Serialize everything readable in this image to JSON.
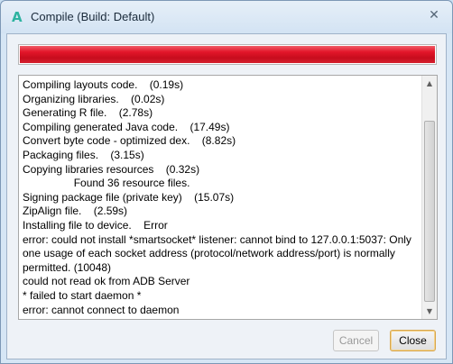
{
  "window": {
    "title": "Compile (Build: Default)",
    "icon": "android-a-icon",
    "close_glyph": "✕"
  },
  "progress": {
    "value": 1.0,
    "color": "#d9182a"
  },
  "log": {
    "lines": [
      "Compiling layouts code.    (0.19s)",
      "Organizing libraries.    (0.02s)",
      "Generating R file.    (2.78s)",
      "Compiling generated Java code.    (17.49s)",
      "Convert byte code - optimized dex.    (8.82s)",
      "Packaging files.    (3.15s)",
      "Copying libraries resources    (0.32s)",
      "                 Found 36 resource files.",
      "Signing package file (private key)    (15.07s)",
      "ZipAlign file.    (2.59s)",
      "Installing file to device.    Error",
      "error: could not install *smartsocket* listener: cannot bind to 127.0.0.1:5037: Only one usage of each socket address (protocol/network address/port) is normally permitted. (10048)",
      "could not read ok from ADB Server",
      "* failed to start daemon *",
      "error: cannot connect to daemon"
    ]
  },
  "buttons": {
    "cancel_label": "Cancel",
    "cancel_enabled": false,
    "close_label": "Close"
  }
}
